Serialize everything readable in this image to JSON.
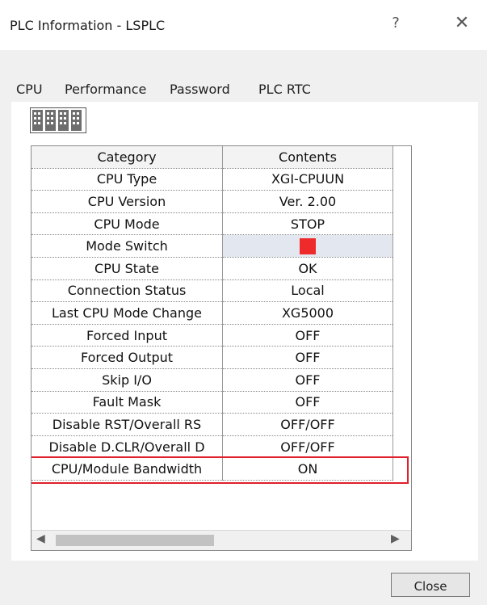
{
  "window": {
    "title": "PLC Information - LSPLC",
    "help_glyph": "?",
    "close_glyph": "✕"
  },
  "tabs": [
    {
      "label": "CPU",
      "active": true
    },
    {
      "label": "Performance",
      "active": false
    },
    {
      "label": "Password",
      "active": false
    },
    {
      "label": "PLC RTC",
      "active": false
    }
  ],
  "table": {
    "headers": [
      "Category",
      "Contents"
    ],
    "rows": [
      {
        "category": "CPU Type",
        "contents": "XGI-CPUUN"
      },
      {
        "category": "CPU Version",
        "contents": "Ver. 2.00"
      },
      {
        "category": "CPU Mode",
        "contents": "STOP"
      },
      {
        "category": "Mode Switch",
        "contents": "",
        "indicator_color": "#ee2a2a"
      },
      {
        "category": "CPU State",
        "contents": "OK"
      },
      {
        "category": "Connection Status",
        "contents": "Local"
      },
      {
        "category": "Last CPU Mode Change",
        "contents": "XG5000"
      },
      {
        "category": "Forced Input",
        "contents": "OFF"
      },
      {
        "category": "Forced Output",
        "contents": "OFF"
      },
      {
        "category": "Skip I/O",
        "contents": "OFF"
      },
      {
        "category": "Fault Mask",
        "contents": "OFF"
      },
      {
        "category": "Disable RST/Overall RS",
        "contents": "OFF/OFF"
      },
      {
        "category": "Disable D.CLR/Overall D",
        "contents": "OFF/OFF"
      },
      {
        "category": "CPU/Module Bandwidth",
        "contents": "ON"
      }
    ]
  },
  "highlight_color": "#e0202a",
  "buttons": {
    "close_label": "Close"
  }
}
